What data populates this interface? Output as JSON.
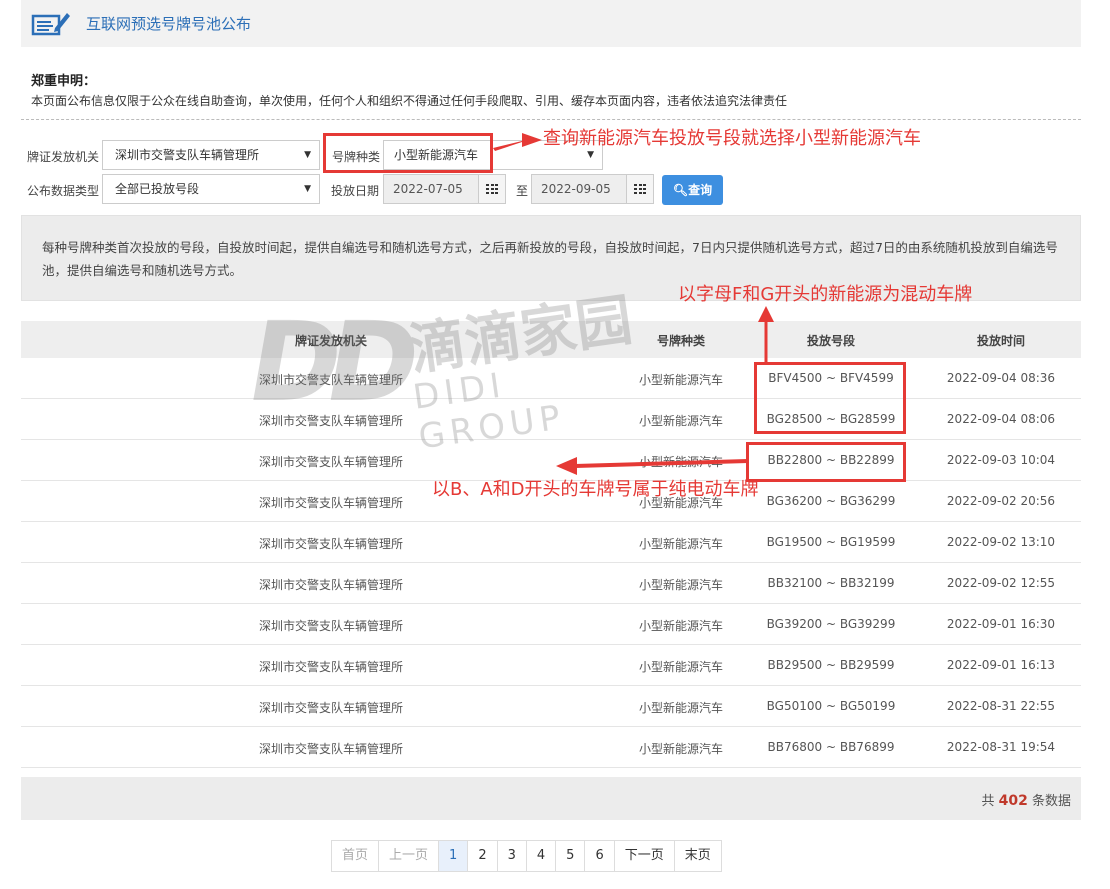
{
  "header": {
    "title": "互联网预选号牌号池公布",
    "icon": "document-pen-icon"
  },
  "notice": {
    "title": "郑重申明：",
    "text": "本页面公布信息仅限于公众在线自助查询，单次使用，任何个人和组织不得通过任何手段爬取、引用、缓存本页面内容，违者依法追究法律责任"
  },
  "form": {
    "issuer_label": "牌证发放机关",
    "issuer_value": "深圳市交警支队车辆管理所",
    "plate_type_label": "号牌种类",
    "plate_type_value": "小型新能源汽车",
    "data_type_label": "公布数据类型",
    "data_type_value": "全部已投放号段",
    "date_label": "投放日期",
    "date_from": "2022-07-05",
    "date_to_label": "至",
    "date_to": "2022-09-05",
    "query_label": "查询",
    "query_icon": "search-icon"
  },
  "info": {
    "text": "每种号牌种类首次投放的号段，自投放时间起，提供自编选号和随机选号方式，之后再新投放的号段，自投放时间起，7日内只提供随机选号方式，超过7日的由系统随机投放到自编选号池，提供自编选号和随机选号方式。"
  },
  "table": {
    "headers": [
      "牌证发放机关",
      "号牌种类",
      "投放号段",
      "投放时间"
    ],
    "rows": [
      [
        "深圳市交警支队车辆管理所",
        "小型新能源汽车",
        "BFV4500 ~ BFV4599",
        "2022-09-04 08:36"
      ],
      [
        "深圳市交警支队车辆管理所",
        "小型新能源汽车",
        "BG28500 ~ BG28599",
        "2022-09-04 08:06"
      ],
      [
        "深圳市交警支队车辆管理所",
        "小型新能源汽车",
        "BB22800 ~ BB22899",
        "2022-09-03 10:04"
      ],
      [
        "深圳市交警支队车辆管理所",
        "小型新能源汽车",
        "BG36200 ~ BG36299",
        "2022-09-02 20:56"
      ],
      [
        "深圳市交警支队车辆管理所",
        "小型新能源汽车",
        "BG19500 ~ BG19599",
        "2022-09-02 13:10"
      ],
      [
        "深圳市交警支队车辆管理所",
        "小型新能源汽车",
        "BB32100 ~ BB32199",
        "2022-09-02 12:55"
      ],
      [
        "深圳市交警支队车辆管理所",
        "小型新能源汽车",
        "BG39200 ~ BG39299",
        "2022-09-01 16:30"
      ],
      [
        "深圳市交警支队车辆管理所",
        "小型新能源汽车",
        "BB29500 ~ BB29599",
        "2022-09-01 16:13"
      ],
      [
        "深圳市交警支队车辆管理所",
        "小型新能源汽车",
        "BG50100 ~ BG50199",
        "2022-08-31 22:55"
      ],
      [
        "深圳市交警支队车辆管理所",
        "小型新能源汽车",
        "BB76800 ~ BB76899",
        "2022-08-31 19:54"
      ]
    ]
  },
  "footer": {
    "prefix": "共",
    "count": "402",
    "suffix": "条数据"
  },
  "pager": {
    "first": "首页",
    "prev": "上一页",
    "pages": [
      "1",
      "2",
      "3",
      "4",
      "5",
      "6"
    ],
    "next": "下一页",
    "last": "末页",
    "current": "1"
  },
  "annotations": {
    "top": "查询新能源汽车投放号段就选择小型新能源汽车",
    "fg": "以字母F和G开头的新能源为混动车牌",
    "bad": "以B、A和D开头的车牌号属于纯电动车牌",
    "color": "#e53935"
  },
  "watermark": {
    "logo": "DD",
    "cn": "滴滴家园",
    "en": "DIDI GROUP"
  },
  "colors": {
    "accent": "#3d8fe0",
    "title": "#2c6fb7",
    "annotation": "#e53935",
    "count": "#c0392b"
  }
}
